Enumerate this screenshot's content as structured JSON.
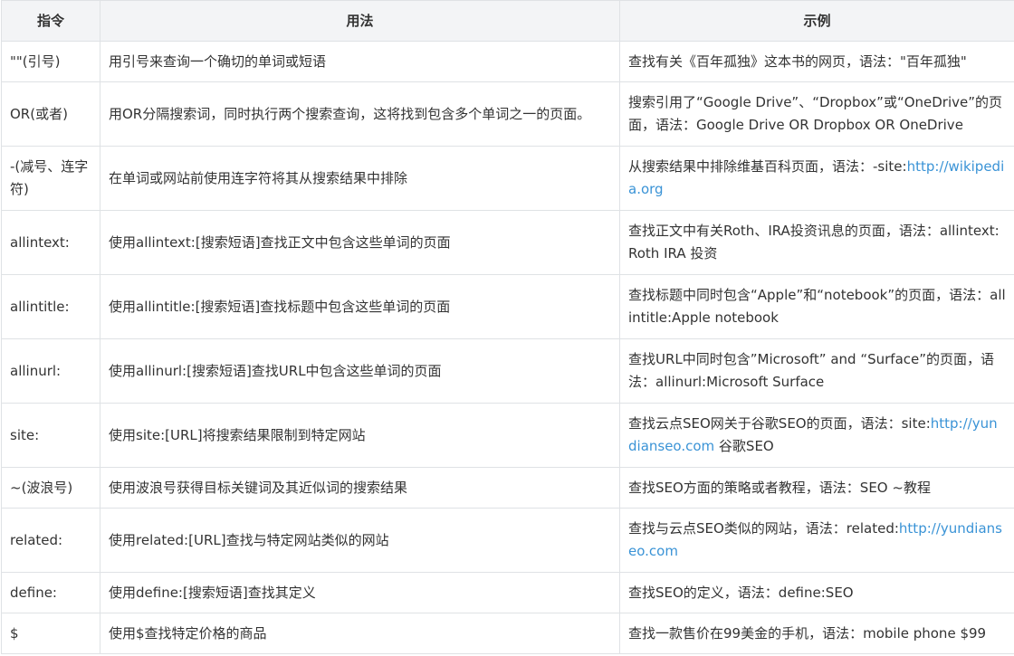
{
  "table": {
    "headers": [
      "指令",
      "用法",
      "示例"
    ],
    "rows": [
      {
        "cmd": "\"\"(引号)",
        "usage": "用引号来查询一个确切的单词或短语",
        "example": "查找有关《百年孤独》这本书的网页，语法：\"百年孤独\"",
        "link": "",
        "suffix": ""
      },
      {
        "cmd": "OR(或者)",
        "usage": "用OR分隔搜索词，同时执行两个搜索查询，这将找到包含多个单词之一的页面。",
        "example": "搜索引用了“Google Drive”、“Dropbox”或“OneDrive”的页面，语法：Google Drive OR Dropbox OR OneDrive",
        "link": "",
        "suffix": ""
      },
      {
        "cmd": "-(减号、连字符)",
        "usage": "在单词或网站前使用连字符将其从搜索结果中排除",
        "example": "从搜索结果中排除维基百科页面，语法：-site:",
        "link": "http://wikipedia.org",
        "suffix": ""
      },
      {
        "cmd": "allintext:",
        "usage": "使用allintext:[搜索短语]查找正文中包含这些单词的页面",
        "example": "查找正文中有关Roth、IRA投资讯息的页面，语法：allintext:Roth IRA 投资",
        "link": "",
        "suffix": ""
      },
      {
        "cmd": "allintitle:",
        "usage": "使用allintitle:[搜索短语]查找标题中包含这些单词的页面",
        "example": "查找标题中同时包含“Apple”和“notebook”的页面，语法：allintitle:Apple notebook",
        "link": "",
        "suffix": ""
      },
      {
        "cmd": "allinurl:",
        "usage": "使用allinurl:[搜索短语]查找URL中包含这些单词的页面",
        "example": "查找URL中同时包含”Microsoft” and “Surface”的页面，语法：allinurl:Microsoft Surface",
        "link": "",
        "suffix": ""
      },
      {
        "cmd": "site:",
        "usage": "使用site:[URL]将搜索结果限制到特定网站",
        "example": "查找云点SEO网关于谷歌SEO的页面，语法：site:",
        "link": "http://yundianseo.com",
        "suffix": " 谷歌SEO"
      },
      {
        "cmd": "~(波浪号)",
        "usage": "使用波浪号获得目标关键词及其近似词的搜索结果",
        "example": "查找SEO方面的策略或者教程，语法：SEO ~教程",
        "link": "",
        "suffix": ""
      },
      {
        "cmd": "related:",
        "usage": "使用related:[URL]查找与特定网站类似的网站",
        "example": "查找与云点SEO类似的网站，语法：related:",
        "link": "http://yundianseo.com",
        "suffix": ""
      },
      {
        "cmd": "define:",
        "usage": "使用define:[搜索短语]查找其定义",
        "example": "查找SEO的定义，语法：define:SEO",
        "link": "",
        "suffix": ""
      },
      {
        "cmd": "$",
        "usage": "使用$查找特定价格的商品",
        "example": "查找一款售价在99美金的手机，语法：mobile phone $99",
        "link": "",
        "suffix": ""
      }
    ]
  },
  "colors": {
    "header_bg": "#f3f4f6",
    "border": "#dfe2e5",
    "link": "#3a93d6",
    "text": "#333333"
  }
}
